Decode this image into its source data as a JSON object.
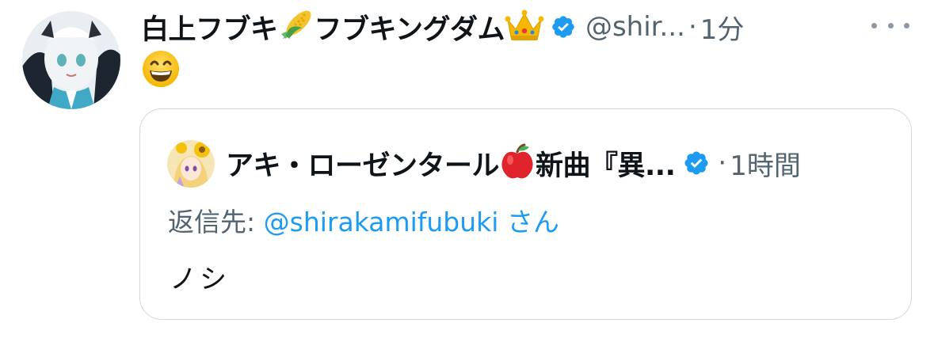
{
  "tweet": {
    "display_name_part1": "白上フブキ",
    "display_name_part2": "フブキングダム",
    "handle": "@shir...",
    "separator": "·",
    "time": "1分",
    "body_emoji": "grinning-face-emoji",
    "more_icon": "more-dots-icon"
  },
  "quote": {
    "display_name_part1": "アキ・ローゼンタール",
    "display_name_part2": "新曲『異...",
    "separator": "·",
    "time": "1時間",
    "reply_label": "返信先:",
    "reply_mention": "@shirakamifubuki",
    "reply_suffix": "さん",
    "text": "ノシ"
  },
  "icons": {
    "corn": "corn-emoji",
    "crown": "crown-emoji",
    "apple": "apple-emoji",
    "verified": "verified-badge-icon"
  },
  "colors": {
    "verified_blue": "#1d9bf0",
    "secondary_text": "#536471",
    "border": "#cfd9de",
    "link": "#1d9bf0"
  }
}
